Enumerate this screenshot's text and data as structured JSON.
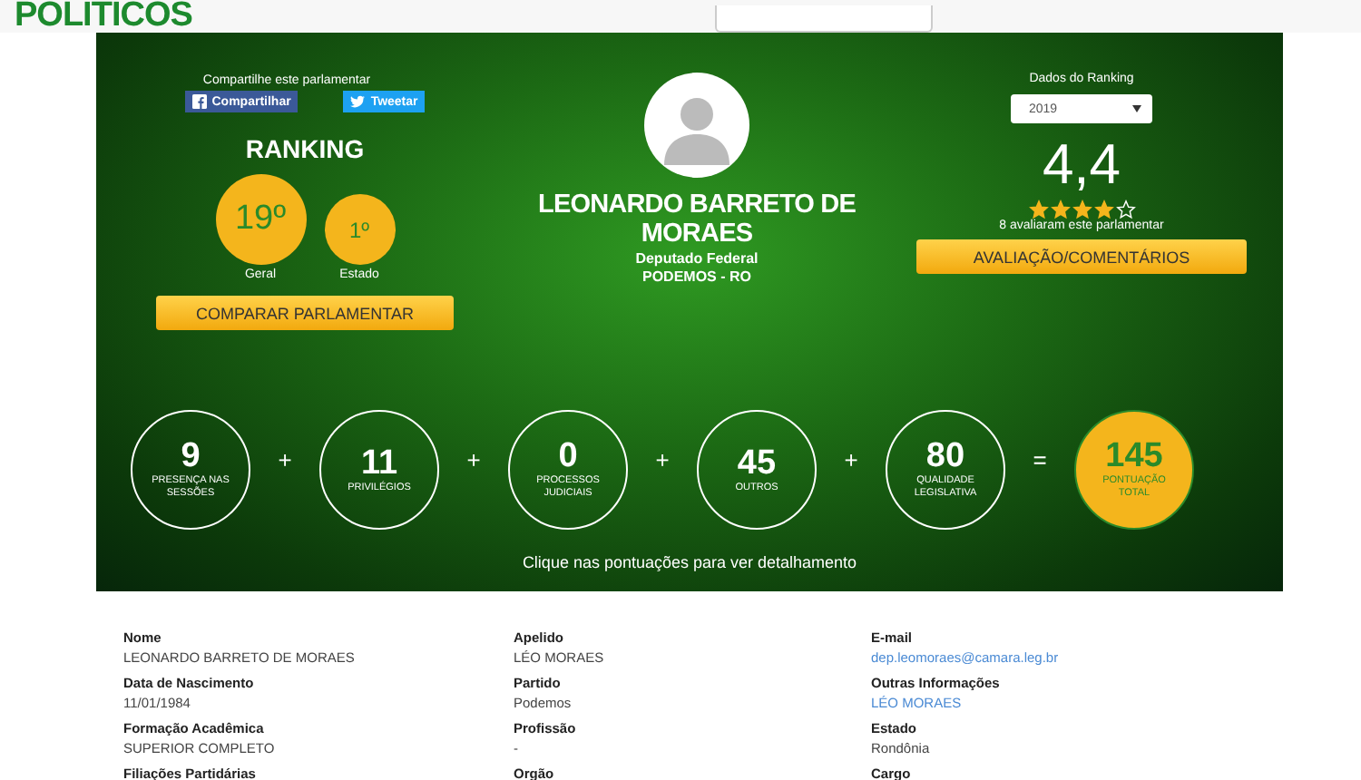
{
  "header": {
    "logo": "POLITICOS"
  },
  "share": {
    "label": "Compartilhe este parlamentar",
    "buttons": [
      {
        "kind": "facebook",
        "label": "Compartilhar"
      },
      {
        "kind": "twitter",
        "label": "Tweetar"
      }
    ]
  },
  "ranking": {
    "title": "RANKING",
    "positions": [
      {
        "value": "19º",
        "label": "Geral",
        "kind": "overall"
      },
      {
        "value": "1º",
        "label": "Estado",
        "kind": "state"
      }
    ],
    "button": "COMPARAR PARLAMENTAR"
  },
  "profile": {
    "name": "LEONARDO BARRETO DE MORAES",
    "role": "Deputado Federal",
    "party": "PODEMOS - RO"
  },
  "rating": {
    "label": "Dados do Ranking",
    "year": "2019",
    "score": "4,4",
    "stars": 4,
    "votes": "8 avaliaram este parlamentar",
    "button": "AVALIAÇÃO/COMENTÁRIOS"
  },
  "scores": [
    {
      "value": "9",
      "label": "PRESENÇA NAS SESSÕES",
      "kind": "part"
    },
    {
      "value": "11",
      "label": "PRIVILÉGIOS",
      "kind": "part"
    },
    {
      "value": "0",
      "label": "PROCESSOS JUDICIAIS",
      "kind": "part"
    },
    {
      "value": "45",
      "label": "OUTROS",
      "kind": "part"
    },
    {
      "value": "80",
      "label": "QUALIDADE LEGISLATIVA",
      "kind": "part"
    },
    {
      "value": "145",
      "label": "PONTUAÇÃO TOTAL",
      "kind": "total"
    }
  ],
  "operators": [
    "+",
    "+",
    "+",
    "+",
    "="
  ],
  "hint": "Clique nas pontuações para ver detalhamento",
  "details": [
    {
      "label": "Nome",
      "value": "LEONARDO BARRETO DE MORAES",
      "kind": "text"
    },
    {
      "label": "Apelido",
      "value": "LÉO MORAES",
      "kind": "text"
    },
    {
      "label": "E-mail",
      "value": "dep.leomoraes@camara.leg.br",
      "kind": "link"
    },
    {
      "label": "Data de Nascimento",
      "value": "11/01/1984",
      "kind": "text"
    },
    {
      "label": "Partido",
      "value": "Podemos",
      "kind": "text"
    },
    {
      "label": "Outras Informações",
      "value": "LÉO MORAES",
      "kind": "link"
    },
    {
      "label": "Formação Acadêmica",
      "value": "SUPERIOR COMPLETO",
      "kind": "text"
    },
    {
      "label": "Profissão",
      "value": "-",
      "kind": "text"
    },
    {
      "label": "Estado",
      "value": "Rondônia",
      "kind": "text"
    },
    {
      "label": "Filiações Partidárias"
    },
    {
      "label": "Orgão"
    },
    {
      "label": "Cargo"
    }
  ]
}
